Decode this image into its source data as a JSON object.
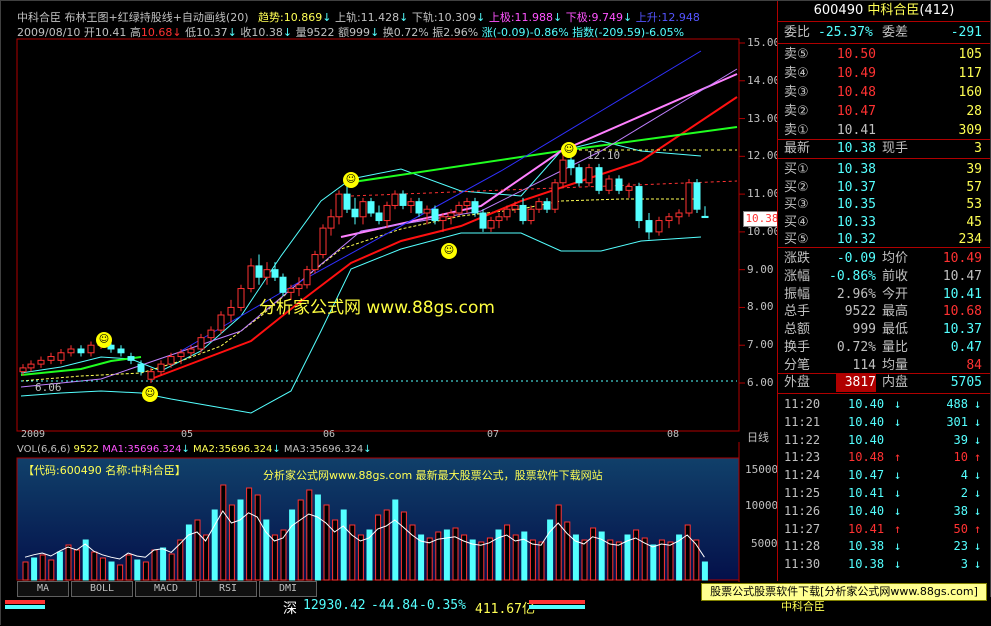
{
  "header": {
    "title_line": "中科合臣  布林王图+红绿持股线+自动画线(20)",
    "trend_label": "趋势:",
    "trend_value": "10.869",
    "upper_label": "上轨:",
    "upper_value": "11.428",
    "lower_label": "下轨:",
    "lower_value": "10.309",
    "upper_limit_label": "上极:",
    "upper_limit_value": "11.988",
    "lower_limit_label": "下极:",
    "lower_limit_value": "9.749",
    "ext_label": "上升:",
    "ext_value": "12.948",
    "date": "2009/08/10",
    "open_label": "开",
    "open_value": "10.41",
    "high_label": "高",
    "high_value": "10.68",
    "low_label": "低",
    "low_value": "10.37",
    "close_label": "收",
    "close_value": "10.38",
    "volume_label": "量",
    "volume_value": "9522",
    "amount_label": "额",
    "amount_value": "999",
    "turnover_label": "换",
    "turnover_value": "0.72%",
    "amplitude_label": "振",
    "amplitude_value": "2.96%",
    "change_label": "涨",
    "change_value": "(-0.09)-0.86%",
    "index_label": "指数",
    "index_value": "(-209.59)-6.05%"
  },
  "watermark": {
    "main": "分析家公式网 www.88gs.com",
    "vol_banner": "分析家公式网www.88gs.com 最新最大股票公式，股票软件下载网站",
    "code_label": "【代码:600490 名称:中科合臣】"
  },
  "price_axis": [
    "15.00",
    "14.00",
    "13.00",
    "12.00",
    "11.00",
    "10.00",
    "9.00",
    "8.00",
    "7.00",
    "6.00"
  ],
  "price_labels": {
    "current": "10.38",
    "peak": "12.10",
    "bottom": "6.06"
  },
  "time_axis": [
    "2009",
    "05",
    "06",
    "07",
    "08"
  ],
  "period_label": "日线",
  "vol_header": {
    "name": "VOL(6,6,6)",
    "value": "9522",
    "ma1": "MA1:35696.324",
    "ma2": "MA2:35696.324",
    "ma3": "MA3:35696.324"
  },
  "vol_axis": [
    "150000",
    "100000",
    "50000"
  ],
  "tabs": [
    "MA",
    "BOLL",
    "MACD",
    "RSI",
    "DMI"
  ],
  "quote": {
    "code": "600490",
    "name": "中科合臣",
    "num": "(412)",
    "ratio_label": "委比",
    "ratio_value": "-25.37%",
    "diff_label": "委差",
    "diff_value": "-291",
    "sells": [
      {
        "label": "卖⑤",
        "price": "10.50",
        "vol": "105"
      },
      {
        "label": "卖④",
        "price": "10.49",
        "vol": "117"
      },
      {
        "label": "卖③",
        "price": "10.48",
        "vol": "160"
      },
      {
        "label": "卖②",
        "price": "10.47",
        "vol": "28"
      },
      {
        "label": "卖①",
        "price": "10.41",
        "vol": "309"
      }
    ],
    "last_label": "最新",
    "last_value": "10.38",
    "now_label": "现手",
    "now_value": "3",
    "buys": [
      {
        "label": "买①",
        "price": "10.38",
        "vol": "39"
      },
      {
        "label": "买②",
        "price": "10.37",
        "vol": "57"
      },
      {
        "label": "买③",
        "price": "10.35",
        "vol": "53"
      },
      {
        "label": "买④",
        "price": "10.33",
        "vol": "45"
      },
      {
        "label": "买⑤",
        "price": "10.32",
        "vol": "234"
      }
    ],
    "stats": [
      {
        "l1": "涨跌",
        "v1": "-0.09",
        "l2": "均价",
        "v2": "10.49"
      },
      {
        "l1": "涨幅",
        "v1": "-0.86%",
        "l2": "前收",
        "v2": "10.47"
      },
      {
        "l1": "振幅",
        "v1": "2.96%",
        "l2": "今开",
        "v2": "10.41"
      },
      {
        "l1": "总手",
        "v1": "9522",
        "l2": "最高",
        "v2": "10.68"
      },
      {
        "l1": "总额",
        "v1": "999",
        "l2": "最低",
        "v2": "10.37"
      },
      {
        "l1": "换手",
        "v1": "0.72%",
        "l2": "量比",
        "v2": "0.47"
      },
      {
        "l1": "分笔",
        "v1": "114",
        "l2": "均量",
        "v2": "84"
      }
    ],
    "outer_label": "外盘",
    "outer_value": "3817",
    "inner_label": "内盘",
    "inner_value": "5705",
    "ticks": [
      {
        "time": "11:20",
        "price": "10.40",
        "dir": "↓",
        "vol": "488"
      },
      {
        "time": "11:21",
        "price": "10.40",
        "dir": "↓",
        "vol": "301"
      },
      {
        "time": "11:22",
        "price": "10.40",
        "dir": "",
        "vol": "39"
      },
      {
        "time": "11:23",
        "price": "10.48",
        "dir": "↑",
        "vol": "10"
      },
      {
        "time": "11:24",
        "price": "10.47",
        "dir": "↓",
        "vol": "4"
      },
      {
        "time": "11:25",
        "price": "10.41",
        "dir": "↓",
        "vol": "2"
      },
      {
        "time": "11:26",
        "price": "10.40",
        "dir": "↓",
        "vol": "38"
      },
      {
        "time": "11:27",
        "price": "10.41",
        "dir": "↑",
        "vol": "50"
      },
      {
        "time": "11:28",
        "price": "10.38",
        "dir": "↓",
        "vol": "23"
      },
      {
        "time": "11:30",
        "price": "10.38",
        "dir": "↓",
        "vol": "3"
      }
    ]
  },
  "status": {
    "market": "深",
    "index": "12930.42",
    "change": "-44.84",
    "pct": "-0.35%",
    "amount": "411.67亿",
    "ticker_text": "股票公式股票软件下载[分析家公式网www.88gs.com]",
    "scroll_text": "中科合臣"
  },
  "colors": {
    "up": "#ff3232",
    "down": "#54ffff",
    "accent": "#ffff54",
    "border": "#b00000"
  }
}
